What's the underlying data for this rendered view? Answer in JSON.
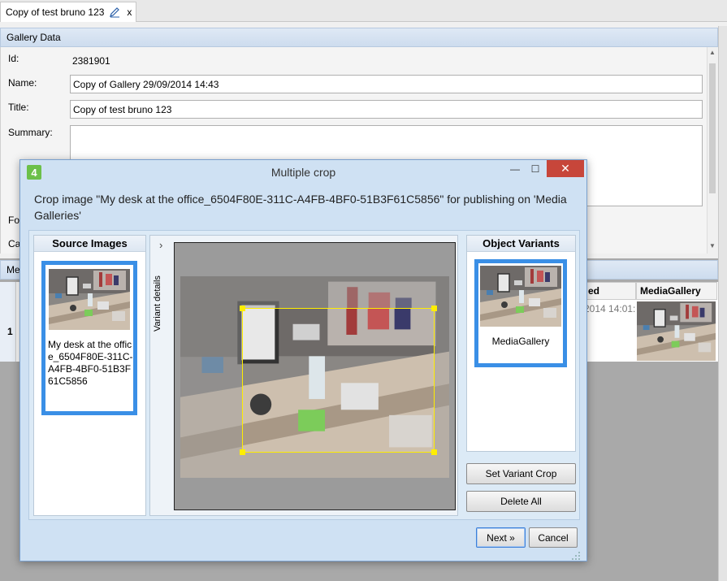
{
  "tab": {
    "title": "Copy of test bruno 123",
    "close": "x"
  },
  "gallery": {
    "header": "Gallery Data",
    "id_label": "Id:",
    "id_value": "2381901",
    "name_label": "Name:",
    "name_value": "Copy of Gallery 29/09/2014 14:43",
    "title_label": "Title:",
    "title_value": "Copy of test bruno 123",
    "summary_label": "Summary:",
    "summary_value": "",
    "folder_label_partial": "Fol",
    "category_label_partial": "Cat"
  },
  "media": {
    "header_partial": "Me",
    "row_number": "1",
    "col_partial": "ed",
    "col_mediagallery": "MediaGallery",
    "cell_date_partial": "2014 14:01:"
  },
  "dialog": {
    "title": "Multiple crop",
    "app_icon": "4",
    "minimize": "—",
    "maximize": "☐",
    "close": "✕",
    "description": "Crop image \"My desk at the office_6504F80E-311C-A4FB-4BF0-51B3F61C5856\" for publishing on 'Media Galleries'",
    "source_header": "Source Images",
    "source_item_label": "My desk at the office_6504F80E-311C-A4FB-4BF0-51B3F61C5856",
    "variant_details": "Variant details",
    "variant_chevron": "›",
    "variants_header": "Object Variants",
    "variant_item_label": "MediaGallery",
    "set_variant_crop": "Set Variant Crop",
    "delete_all": "Delete All",
    "next": "Next »",
    "cancel": "Cancel"
  },
  "colors": {
    "accent_border": "#3a8fe6",
    "crop_outline": "#ffee00",
    "close_button": "#c7463a"
  }
}
